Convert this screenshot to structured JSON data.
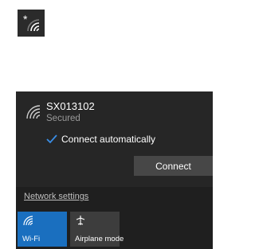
{
  "tray": {
    "icon": "wifi-secured-icon",
    "badge": "*"
  },
  "network": {
    "ssid": "SX013102",
    "status": "Secured",
    "auto_connect_label": "Connect automatically",
    "auto_connect_checked": true,
    "connect_label": "Connect"
  },
  "footer": {
    "settings_link": "Network settings",
    "tiles": [
      {
        "label": "Wi-Fi",
        "icon": "wifi-icon",
        "active": true
      },
      {
        "label": "Airplane mode",
        "icon": "airplane-icon",
        "active": false
      }
    ]
  },
  "colors": {
    "accent": "#1a6fbf",
    "panel": "#1f1f1f",
    "entry": "#262626"
  }
}
